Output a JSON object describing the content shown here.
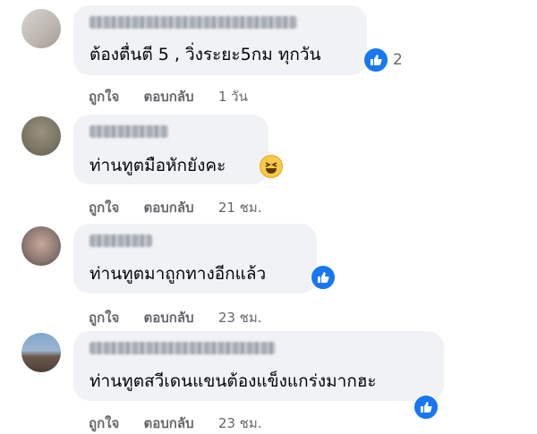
{
  "comments": [
    {
      "text": "ต้องตื่นตี 5 , วิ่งระยะ5กม ทุกวัน",
      "reaction_count": "2",
      "reaction": "like-icon",
      "actions": {
        "like": "ถูกใจ",
        "reply": "ตอบกลับ",
        "time": "1 วัน"
      }
    },
    {
      "text": "ท่านทูตมือหักยังคะ",
      "reaction": "haha-emoji-icon",
      "actions": {
        "like": "ถูกใจ",
        "reply": "ตอบกลับ",
        "time": "21 ชม."
      }
    },
    {
      "text": "ท่านทูตมาถูกทางอีกแล้ว",
      "reaction": "like-icon",
      "actions": {
        "like": "ถูกใจ",
        "reply": "ตอบกลับ",
        "time": "23 ชม."
      }
    },
    {
      "text": "ท่านทูตสวีเดนแขนต้องแข็งแกร่งมากฮะ",
      "reaction": "like-icon",
      "actions": {
        "like": "ถูกใจ",
        "reply": "ตอบกลับ",
        "time": "23 ชม."
      }
    }
  ],
  "colors": {
    "bubble": "#f0f2f5",
    "meta": "#65676b",
    "like_blue": "#1877f2"
  }
}
